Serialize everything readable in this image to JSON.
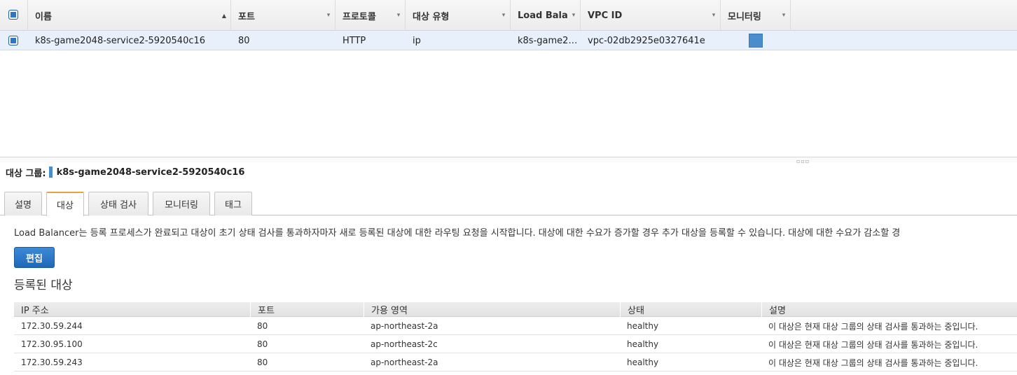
{
  "grid": {
    "columns": [
      {
        "label": "이름",
        "sort": "▲"
      },
      {
        "label": "포트"
      },
      {
        "label": "프로토콜"
      },
      {
        "label": "대상 유형"
      },
      {
        "label": "Load Balancer"
      },
      {
        "label": "VPC ID"
      },
      {
        "label": "모니터링"
      }
    ],
    "dropdown_glyph": "▾",
    "row": {
      "name": "k8s-game2048-service2-5920540c16",
      "port": "80",
      "protocol": "HTTP",
      "target_type": "ip",
      "load_balancer": "k8s-game2…",
      "vpc_id": "vpc-02db2925e0327641e"
    }
  },
  "target_group": {
    "label": "대상 그룹:",
    "name": "k8s-game2048-service2-5920540c16"
  },
  "tabs": [
    "설명",
    "대상",
    "상태 검사",
    "모니터링",
    "태그"
  ],
  "description": "Load Balancer는 등록 프로세스가 완료되고 대상이 초기 상태 검사를 통과하자마자 새로 등록된 대상에 대한 라우팅 요청을 시작합니다. 대상에 대한 수요가 증가할 경우 추가 대상을 등록할 수 있습니다. 대상에 대한 수요가 감소할 경",
  "edit_button": "편집",
  "registered_title": "등록된 대상",
  "targets_table": {
    "headers": [
      "IP 주소",
      "포트",
      "가용 영역",
      "상태",
      "설명"
    ],
    "rows": [
      [
        "172.30.59.244",
        "80",
        "ap-northeast-2a",
        "healthy",
        "이 대상은 현재 대상 그룹의 상태 검사를 통과하는 중입니다."
      ],
      [
        "172.30.95.100",
        "80",
        "ap-northeast-2c",
        "healthy",
        "이 대상은 현재 대상 그룹의 상태 검사를 통과하는 중입니다."
      ],
      [
        "172.30.59.243",
        "80",
        "ap-northeast-2a",
        "healthy",
        "이 대상은 현재 대상 그룹의 상태 검사를 통과하는 중입니다."
      ]
    ]
  },
  "colors": {
    "accent": "#2e74c8",
    "selected_row": "#e8f1fb",
    "active_tab": "#e8a33c",
    "monitor_square": "#4a8ccc"
  }
}
